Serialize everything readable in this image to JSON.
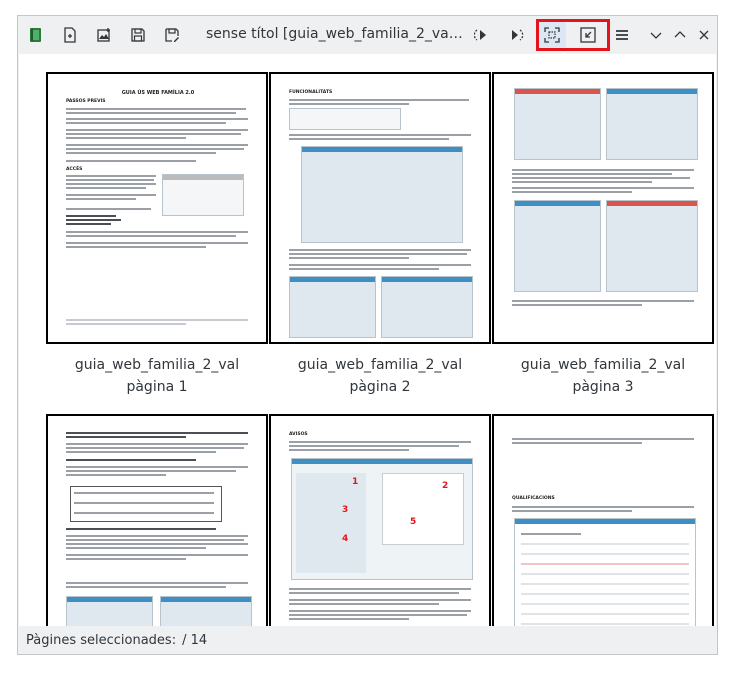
{
  "window": {
    "title": "sense títol [guia_web_familia_2_val] – ..."
  },
  "toolbar": {
    "icons": [
      "app-icon",
      "new-page-icon",
      "insert-image-icon",
      "save-icon",
      "save-as-icon",
      "rotate-left-icon",
      "rotate-right-icon",
      "zoom-fit-icon",
      "zoom-shrink-icon",
      "menu-icon",
      "minimize-icon",
      "maximize-icon",
      "close-icon"
    ]
  },
  "pages": [
    {
      "file": "guia_web_familia_2_val",
      "label": "pàgina 1"
    },
    {
      "file": "guia_web_familia_2_val",
      "label": "pàgina 2"
    },
    {
      "file": "guia_web_familia_2_val",
      "label": "pàgina 3"
    },
    {
      "file": "",
      "label": ""
    },
    {
      "file": "",
      "label": ""
    },
    {
      "file": "",
      "label": ""
    }
  ],
  "thumbs": {
    "p1_title": "GUIA ÚS WEB FAMÍLIA 2.0",
    "p1_h1": "PASSOS PREVIS",
    "p1_h2": "ACCÉS",
    "p2_h1": "FUNCIONALITATS",
    "p4_h1": "",
    "p5_h1": "AVISOS",
    "p6_h1": "QUALIFICACIONS"
  },
  "status": {
    "selected_label": "Pàgines seleccionades:",
    "selected_value": "/ 14"
  }
}
